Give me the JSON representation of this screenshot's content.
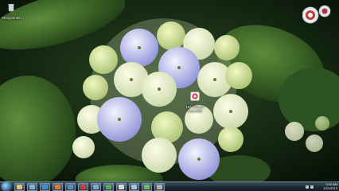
{
  "desktop": {
    "icons": [
      {
        "label": "Recycle Bin"
      },
      {
        "label": "HD Screen\nRecorder"
      }
    ]
  },
  "taskbar": {
    "pinned": [
      "folder",
      "media",
      "ie",
      "firefox",
      "media-player",
      "screen-recorder",
      "explorer",
      "chrome",
      "paint",
      "notepad",
      "messenger",
      "settings"
    ],
    "clock_time": "3:42 AM",
    "clock_date": "1/21/2013"
  }
}
